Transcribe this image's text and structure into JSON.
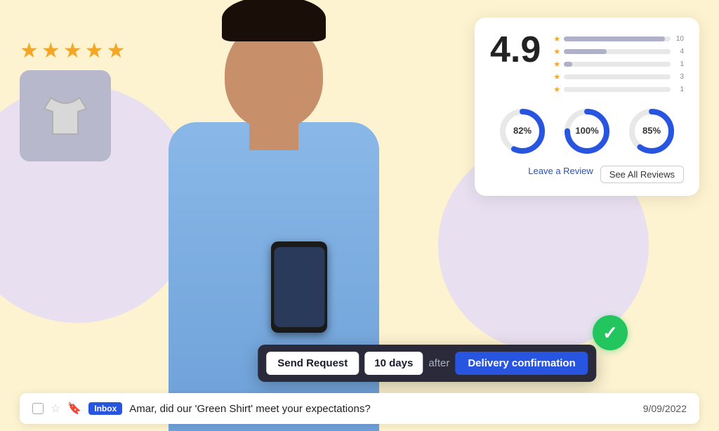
{
  "background_color": "#fdf3d0",
  "stars": {
    "count": 5,
    "filled": 5,
    "color": "#f5a623"
  },
  "product_card": {
    "emoji": "👕"
  },
  "reviews_panel": {
    "rating": "4.9",
    "bars": [
      {
        "stars": "★",
        "fill_pct": 95,
        "count": "10"
      },
      {
        "stars": "★",
        "fill_pct": 40,
        "count": "4"
      },
      {
        "stars": "★",
        "fill_pct": 8,
        "count": "1"
      },
      {
        "stars": "★",
        "fill_pct": 0,
        "count": "3"
      },
      {
        "stars": "★",
        "fill_pct": 0,
        "count": "1"
      }
    ],
    "donuts": [
      {
        "label": "82%",
        "pct": 82
      },
      {
        "label": "100%",
        "pct": 100
      },
      {
        "label": "85%",
        "pct": 85
      }
    ],
    "leave_review_label": "Leave a Review",
    "see_all_label": "See All Reviews"
  },
  "toolbar": {
    "send_request_label": "Send Request",
    "days_label": "10 days",
    "after_label": "after",
    "delivery_label": "Delivery confirmation"
  },
  "email_bar": {
    "inbox_badge": "Inbox",
    "subject": "Amar, did our 'Green Shirt' meet your expectations?",
    "date": "9/09/2022"
  }
}
